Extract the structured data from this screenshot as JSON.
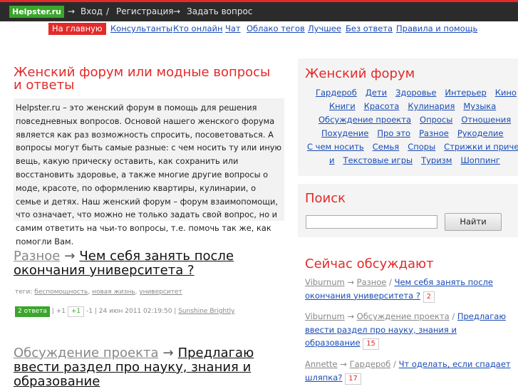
{
  "topbar": {
    "logo": "Helpster.ru",
    "arrow": "→",
    "login": "Вход",
    "slash": "/",
    "register": "Регистрация",
    "ask": "Задать вопрос"
  },
  "nav": {
    "home": "На главную",
    "items": [
      "Консультанты",
      "Кто онлайн",
      "Чат",
      "Облако тегов",
      "Лучшее",
      "Без ответа",
      "Правила и помощь"
    ]
  },
  "main": {
    "title": "Женский форум или модные вопросы и ответы",
    "intro": "Helpster.ru – это женский форум в помощь для решения повседневных вопросов. Основой нашего женского форума является как раз возможность спросить, посоветоваться. А вопросы могут быть самые разные: с чем носить ту или иную вещь, какую прическу оставить, как сохранить или восстановить здоровье, а также многие другие вопросы о моде, красоте, по оформлению квартиры, кулинарии, о семье и детях. Наш женский форум – форум взаимопомощи, что означает, что можно не только задать свой вопрос, но и самим ответить на чьи-то вопросы, т.е. помочь так же, как помогли Вам.",
    "posts": [
      {
        "category": "Разное",
        "arrow": "→",
        "question": "Чем себя занять после окончания университета ?",
        "tags_label": "теги:",
        "tags": [
          "беспомощность",
          "новая жизнь",
          "университет"
        ],
        "answers": "2 ответа",
        "votes_plus": "+1",
        "plus_button": "+1",
        "votes_minus": "-1",
        "date": "24 июн 2011 02:19:50",
        "author": "Sunshine Brightly"
      },
      {
        "category": "Обсуждение проекта",
        "arrow": "→",
        "question": "Предлагаю ввести раздел про науку, знания и образование"
      }
    ]
  },
  "sidebar": {
    "forum_title": "Женский форум",
    "cloud_rows": [
      [
        "Гардероб",
        "Дети",
        "Здоровье",
        "Интерьер",
        "Кино"
      ],
      [
        "Книги",
        "Красота",
        "Кулинария",
        "Музыка"
      ],
      [
        "Обсуждение проекта",
        "Опросы",
        "Отношения"
      ],
      [
        "Похудение",
        "Про это",
        "Разное",
        "Рукоделие"
      ],
      [
        "С чем носить",
        "Семья",
        "Споры",
        "Стрижки и прическ"
      ],
      [
        "и",
        "Текстовые игры",
        "Туризм",
        "Шоппинг"
      ]
    ],
    "search_title": "Поиск",
    "search_value": "",
    "search_button": "Найти",
    "discuss_title": "Сейчас обсуждают",
    "discussions": [
      {
        "user": "Viburnum",
        "category": "Разное",
        "question": "Чем себя занять после окончания университета ?",
        "count": "2"
      },
      {
        "user": "Viburnum",
        "category": "Обсуждение проекта",
        "question": "Предлагаю ввести раздел про науку, знания и образование",
        "count": "15"
      },
      {
        "user": "Annette",
        "category": "Гардероб",
        "question": "Чт оделать, если спадает шляпка?",
        "count": "17"
      }
    ]
  },
  "colors": {
    "accent_red": "#e32a2a",
    "green": "#3aa62b",
    "link_blue": "#1a4bb5",
    "topbar_dark": "#2b2b2b"
  }
}
